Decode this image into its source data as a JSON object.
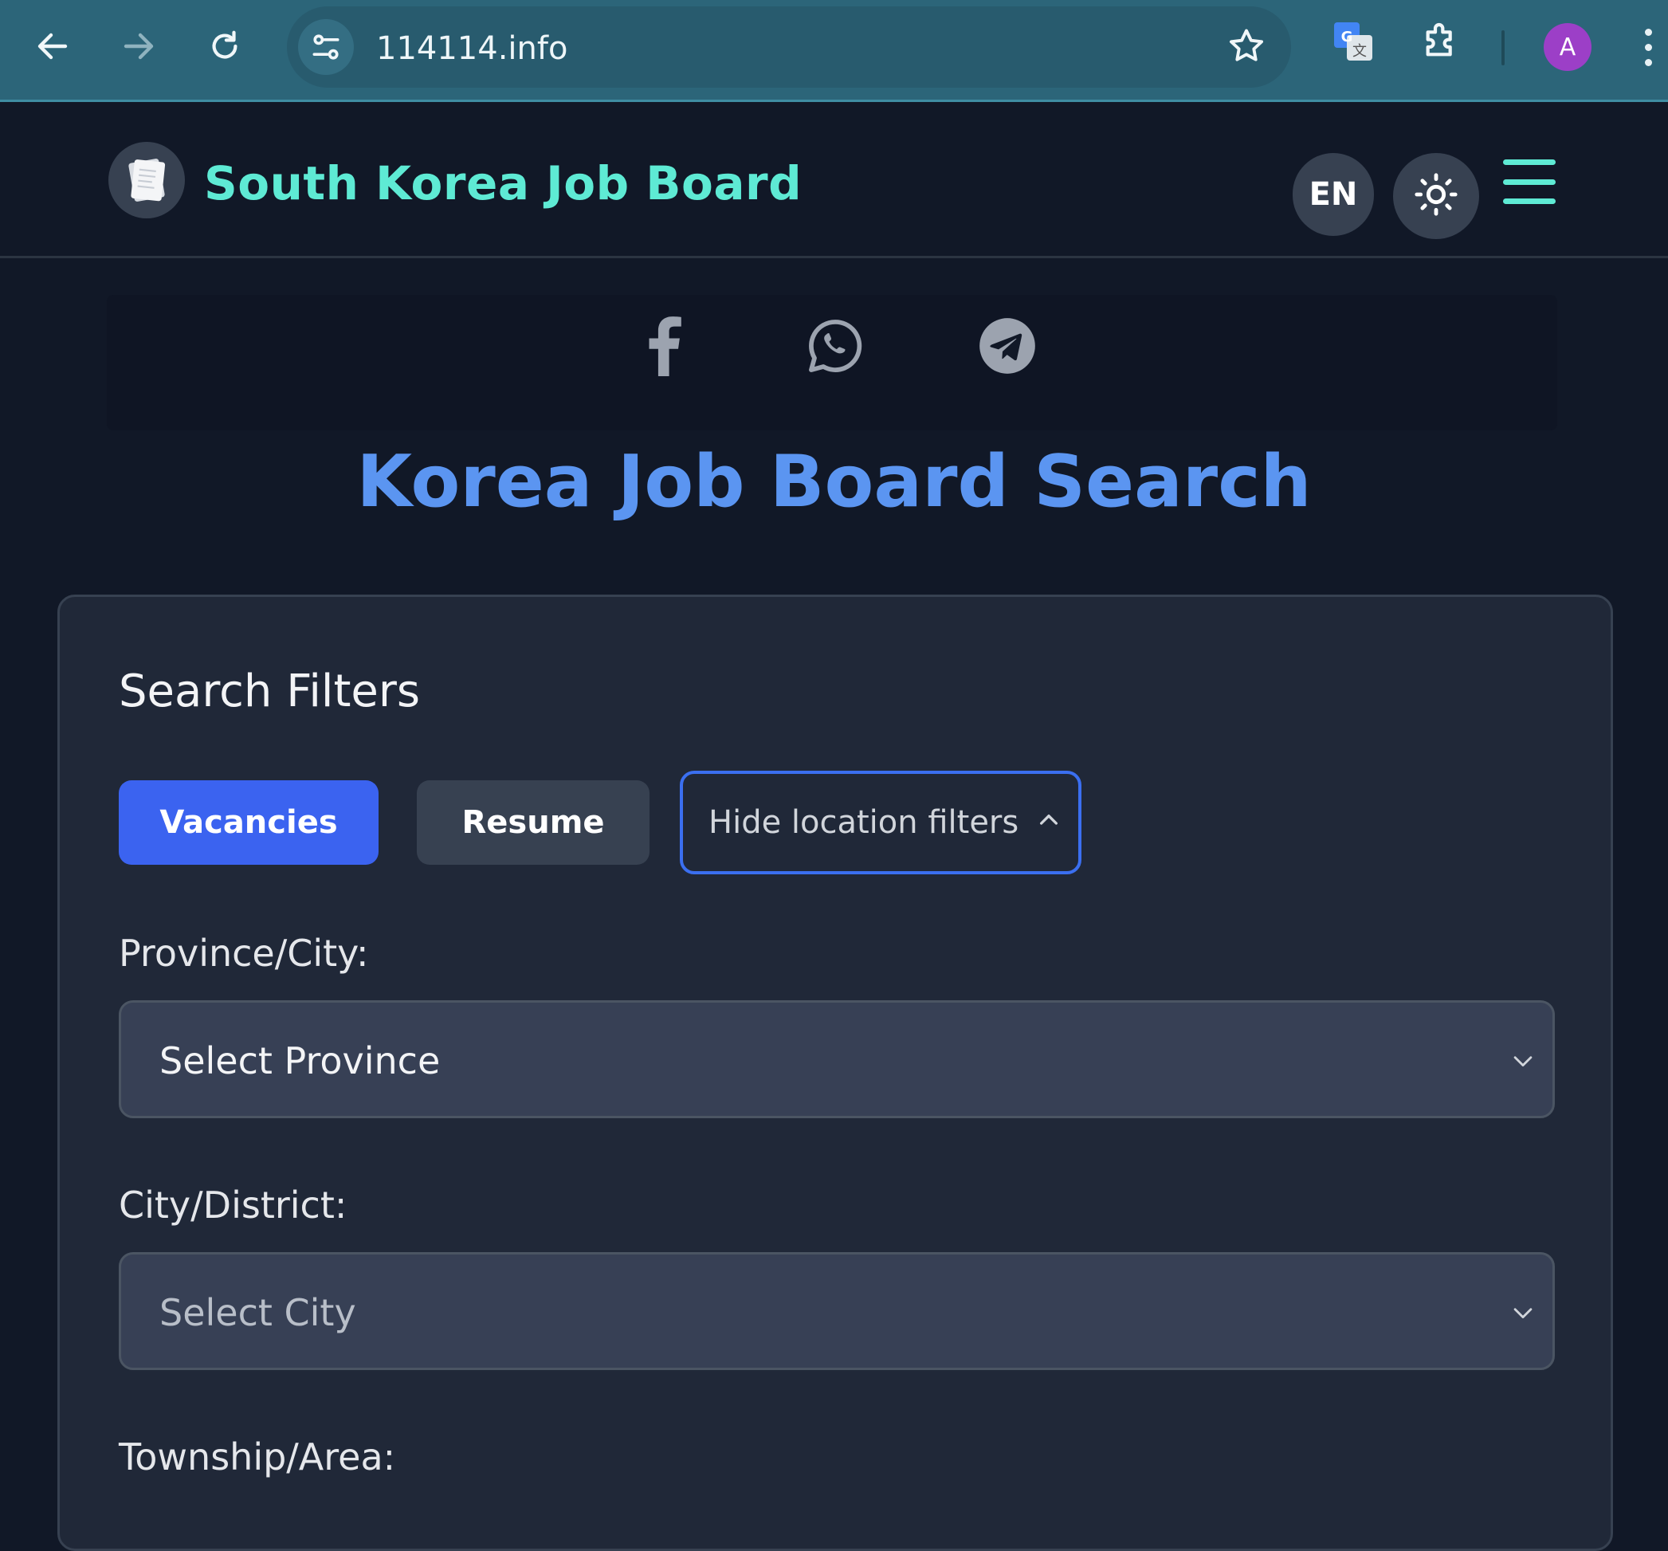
{
  "browser": {
    "url": "114114.info",
    "profile_initial": "A",
    "icons": [
      "back-icon",
      "forward-icon",
      "reload-icon",
      "site-settings-icon",
      "bookmark-star-icon",
      "google-translate-icon",
      "extensions-icon",
      "more-menu-icon"
    ]
  },
  "header": {
    "brand": "South Korea Job Board",
    "language": "EN",
    "colors": {
      "brand": "#5eead4",
      "header_bg": "#111827"
    }
  },
  "social": {
    "icons": [
      "facebook-icon",
      "whatsapp-icon",
      "telegram-icon"
    ]
  },
  "page": {
    "title": "Korea Job Board Search",
    "title_color": "#5b95f1"
  },
  "filters": {
    "title": "Search Filters",
    "tabs": [
      {
        "label": "Vacancies",
        "active": true
      },
      {
        "label": "Resume",
        "active": false
      }
    ],
    "toggle_label": "Hide location filters",
    "fields": [
      {
        "label": "Province/City:",
        "value": "Select Province"
      },
      {
        "label": "City/District:",
        "value": "Select City"
      },
      {
        "label": "Township/Area:"
      }
    ],
    "colors": {
      "active_tab": "#3b63f0",
      "card_bg": "#202838"
    }
  }
}
